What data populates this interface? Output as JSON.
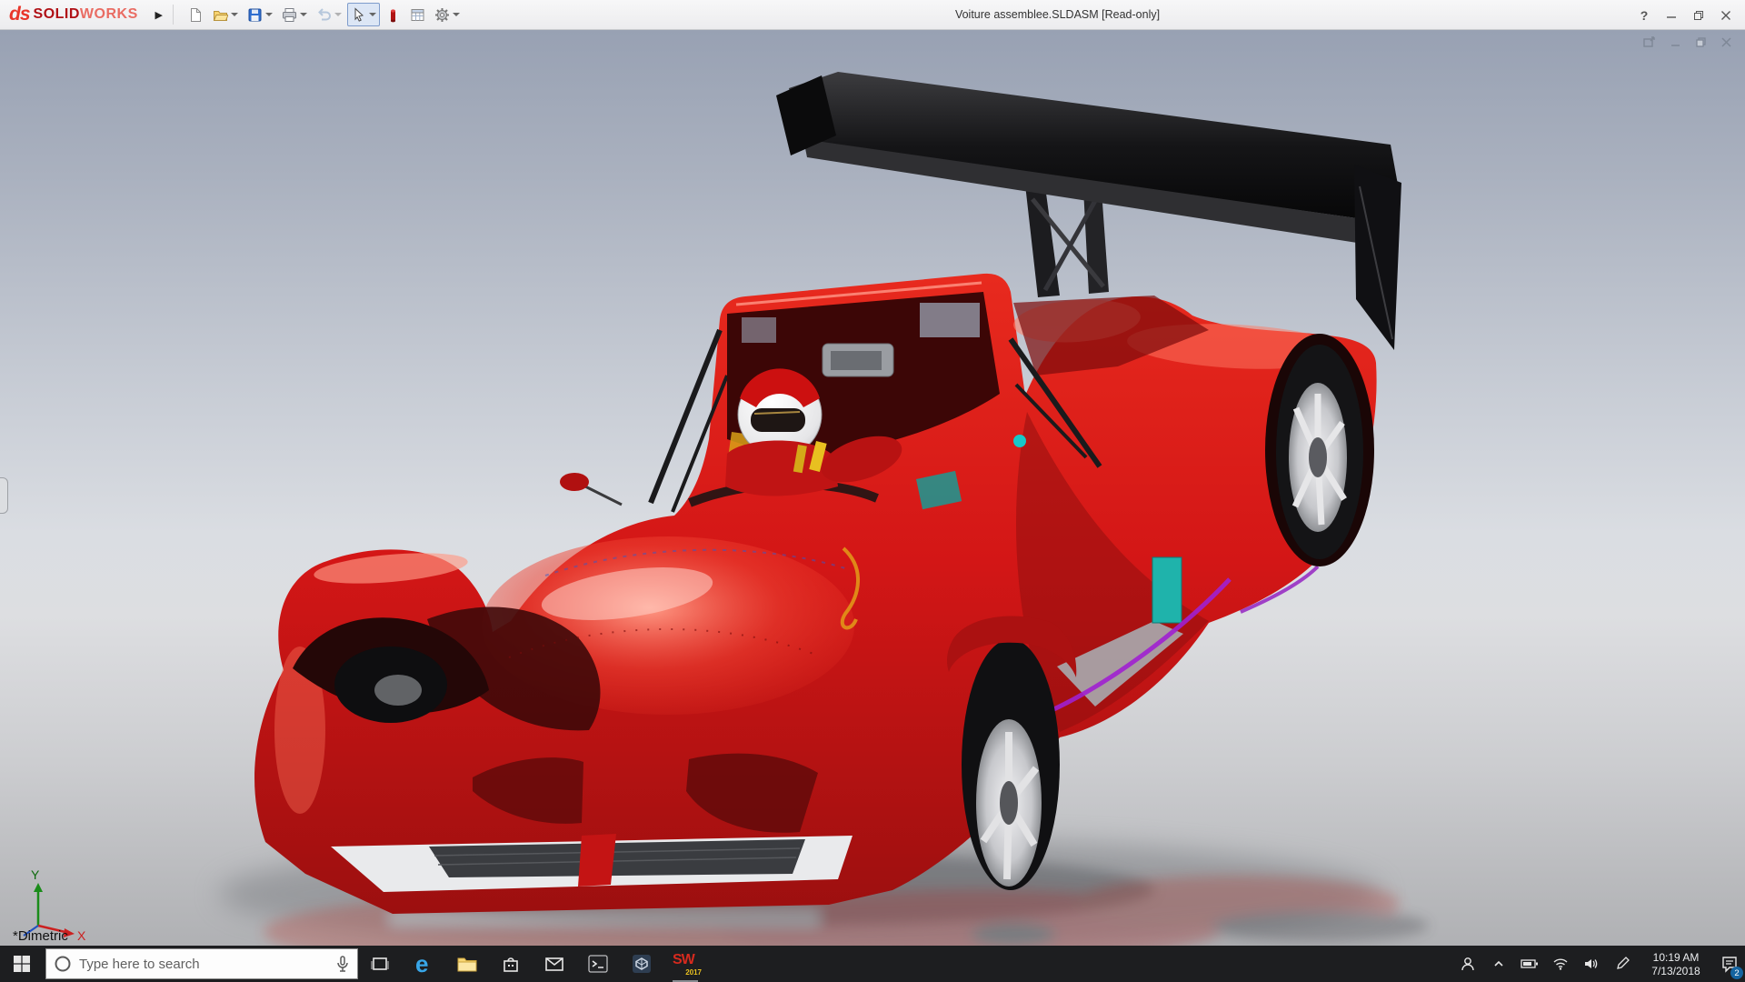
{
  "titlebar": {
    "logo": {
      "ds": "ds",
      "solid": "SOLID",
      "works": "WORKS"
    },
    "expand_arrow": "▶",
    "document_title": "Voiture assemblee.SLDASM [Read-only]",
    "help_glyph": "?",
    "tools": [
      {
        "name": "new-document",
        "dropdown": false,
        "active": false
      },
      {
        "name": "open",
        "dropdown": true,
        "active": false
      },
      {
        "name": "save",
        "dropdown": true,
        "active": false
      },
      {
        "name": "print",
        "dropdown": true,
        "active": false
      },
      {
        "name": "undo",
        "dropdown": true,
        "active": false,
        "disabled": true
      },
      {
        "name": "select",
        "dropdown": true,
        "active": true
      },
      {
        "name": "appearance",
        "dropdown": false,
        "active": false
      },
      {
        "name": "design-table",
        "dropdown": false,
        "active": false
      },
      {
        "name": "options",
        "dropdown": true,
        "active": false
      }
    ]
  },
  "viewport": {
    "view_orientation": "*Dimetric",
    "triad": {
      "x": "X",
      "y": "Y"
    },
    "model": {
      "body_color": "#d31616",
      "wing_color": "#111111",
      "helmet_colors": [
        "#ffffff",
        "#cc1010"
      ],
      "accent_colors": {
        "teal": "#1fb3ab",
        "purple": "#a020d0",
        "harness_yellow": "#e8c020"
      }
    }
  },
  "taskbar": {
    "search": {
      "placeholder": "Type here to search"
    },
    "edge_glyph": "e",
    "pinned_icons": [
      "task-view",
      "edge",
      "file-explorer",
      "store",
      "mail",
      "console",
      "edrawings",
      "solidworks"
    ],
    "tray_icons": [
      "people",
      "chevron-up",
      "battery",
      "network",
      "volume",
      "pen",
      "action-center"
    ],
    "solidworks_badge": {
      "letters": "SW",
      "year": "2017"
    },
    "clock": {
      "time": "10:19 AM",
      "date": "7/13/2018"
    },
    "notifications": {
      "count": "2"
    },
    "colors": {
      "bar": "#1d1e20",
      "accent": "#1464a0"
    }
  }
}
